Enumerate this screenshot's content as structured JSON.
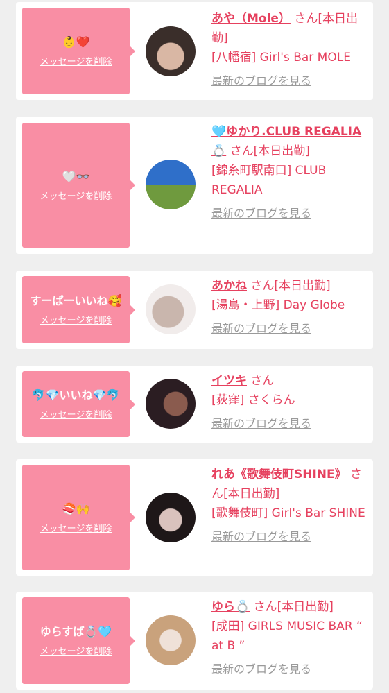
{
  "actions": {
    "delete_label": "メッセージを削除",
    "blog_label": "最新のブログを見る"
  },
  "cards": [
    {
      "message": "👶❤️",
      "name": "あや（Mole）",
      "suffix": "さん[本日出勤]",
      "shop": "[八幡宿] Girl's Bar MOLE",
      "avatar_colors": [
        "#3a2e2a",
        "#d9b7a4"
      ]
    },
    {
      "message": "🤍👓",
      "name": "🩵ゆかり.CLUB REGALIA💍",
      "suffix": "さん[本日出勤]",
      "shop": "[錦糸町駅南口] CLUB REGALIA",
      "avatar_colors": [
        "#2f6fc9",
        "#6f9a3e"
      ]
    },
    {
      "message": "すーぱーいいね🥰",
      "name": "あかね",
      "suffix": "さん[本日出勤]",
      "shop": "[湯島・上野] Day Globe",
      "avatar_colors": [
        "#f1eceb",
        "#c9b6ad"
      ]
    },
    {
      "message": "🐬💎いいね💎🐬",
      "name": "イツキ",
      "suffix": "さん",
      "shop": "[荻窪] さくらん",
      "avatar_colors": [
        "#2b1d22",
        "#8a5b4e"
      ]
    },
    {
      "message": "🍣🙌",
      "name": "れあ《歌舞伎町SHINE》",
      "suffix": "さん[本日出勤]",
      "shop": "[歌舞伎町] Girl's Bar SHINE",
      "avatar_colors": [
        "#1e1718",
        "#d9c2bd"
      ]
    },
    {
      "message": "ゆらすぱ💍🩵",
      "name": "ゆら💍",
      "suffix": "さん[本日出勤]",
      "shop": "[成田] GIRLS MUSIC BAR “ at B ”",
      "avatar_colors": [
        "#c9a27c",
        "#efe1d8"
      ]
    }
  ]
}
